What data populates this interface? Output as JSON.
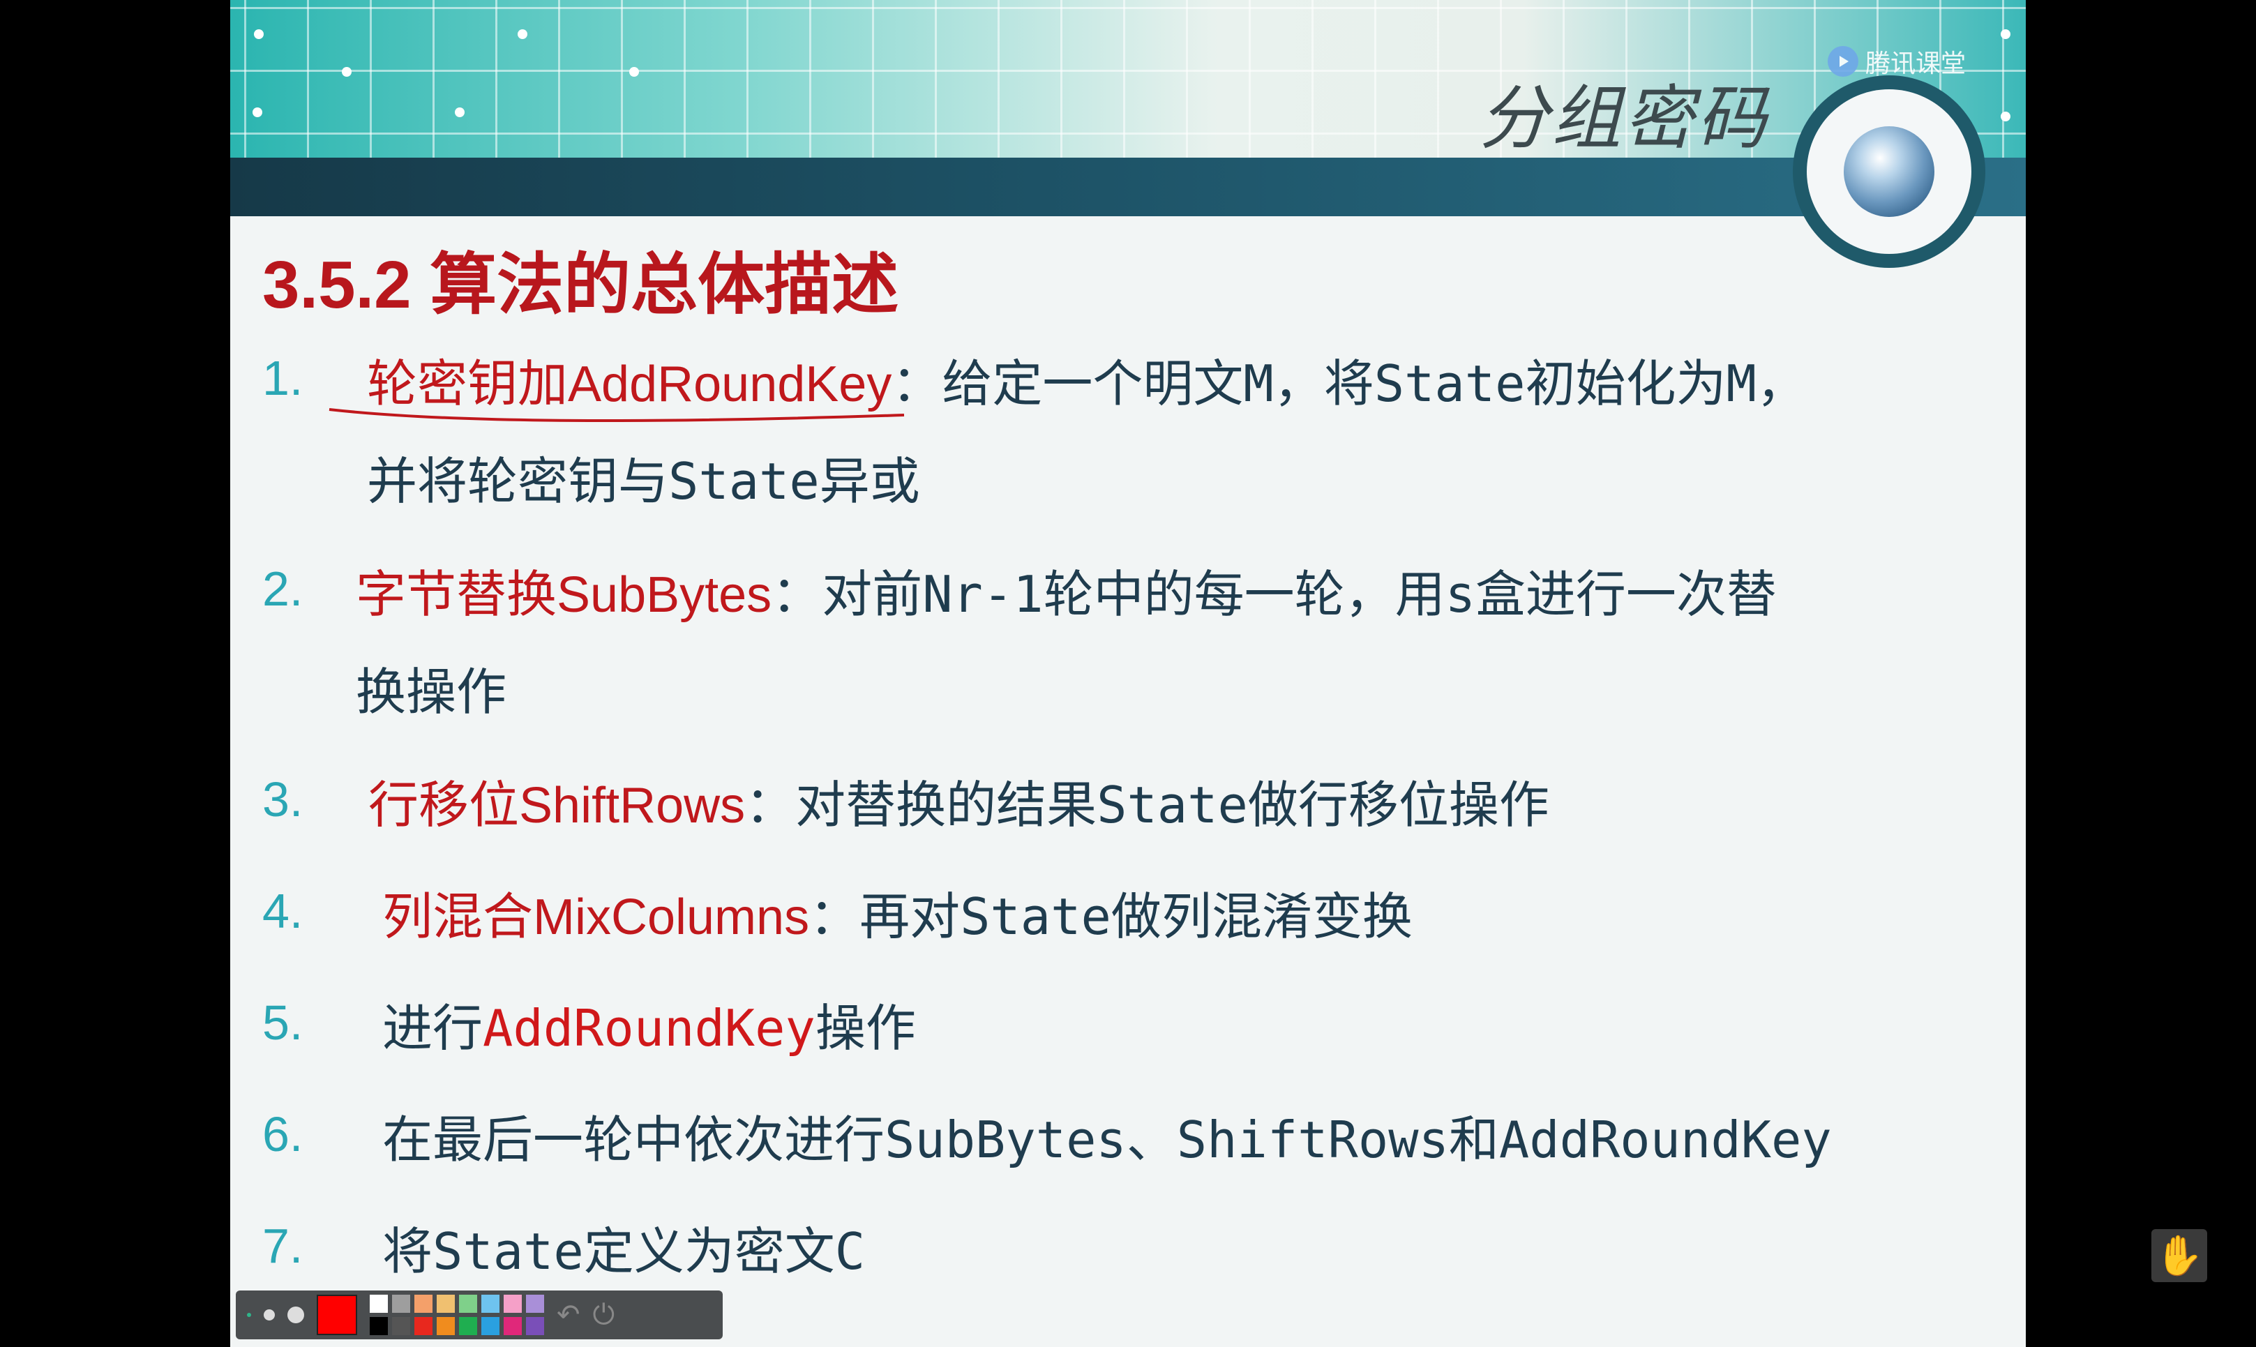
{
  "header": {
    "title": "分组密码",
    "brand": "腾讯课堂"
  },
  "section": {
    "title": "3.5.2 算法的总体描述"
  },
  "items": [
    {
      "num": "1.",
      "red": "轮密钥加AddRoundKey",
      "text_line1": "：给定一个明文M，将State初始化为M，",
      "text_line2": "并将轮密钥与State异或"
    },
    {
      "num": "2.",
      "red": "字节替换SubBytes",
      "text_line1": "：对前Nr-1轮中的每一轮，用s盒进行一次替",
      "text_line2": "换操作"
    },
    {
      "num": "3.",
      "red": "行移位ShiftRows",
      "text_line1": "：对替换的结果State做行移位操作"
    },
    {
      "num": "4.",
      "red": "列混合MixColumns",
      "text_line1": "：再对State做列混淆变换"
    },
    {
      "num": "5.",
      "pre": "进行",
      "red": "AddRoundKey",
      "post": "操作"
    },
    {
      "num": "6.",
      "text_line1": "在最后一轮中依次进行SubBytes、ShiftRows和AddRoundKey"
    },
    {
      "num": "7.",
      "text_line1": "将State定义为密文C"
    }
  ],
  "toolbar": {
    "current_color": "#ff0000",
    "palette": [
      "#ffffff",
      "#9e9e9e",
      "#f4a06a",
      "#f0c070",
      "#7fd08a",
      "#6ec3ef",
      "#f5a0c8",
      "#a98fd8",
      "#000000",
      "#555555",
      "#e8281e",
      "#f08c1e",
      "#1fae50",
      "#2aa0e0",
      "#e0287a",
      "#7a4fb8"
    ],
    "icons": [
      "pen-thin-icon",
      "pen-medium-icon",
      "pen-thick-icon",
      "undo-icon",
      "power-icon"
    ]
  },
  "colors": {
    "accent_red": "#c0181c",
    "number_teal": "#2aa6b4",
    "body_text": "#1f3c4e"
  }
}
